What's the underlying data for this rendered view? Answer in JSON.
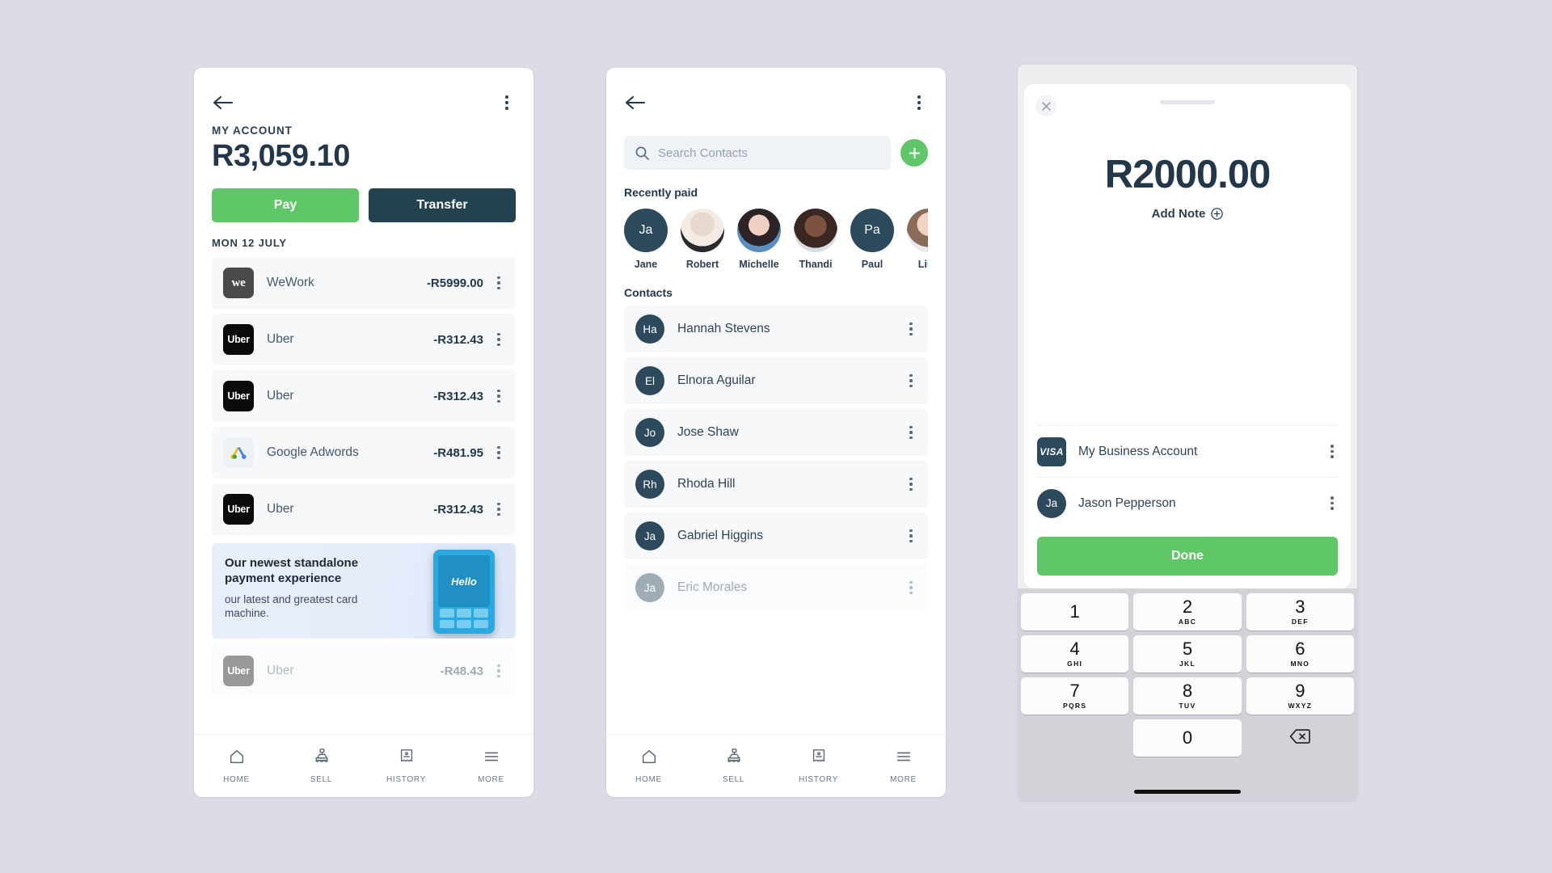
{
  "colors": {
    "green": "#5fc767",
    "dark_navy": "#23424f",
    "page_bg": "#dcdce6",
    "text_dark": "#22384a"
  },
  "phone1": {
    "back_icon": "arrow-left-icon",
    "menu_icon": "kebab-menu-icon",
    "account_label": "MY ACCOUNT",
    "balance": "R3,059.10",
    "pay_label": "Pay",
    "transfer_label": "Transfer",
    "date_label": "MON 12 JULY",
    "transactions": [
      {
        "logo": "wework-logo",
        "logo_text": "we",
        "name": "WeWork",
        "amount": "-R5999.00"
      },
      {
        "logo": "uber-logo",
        "logo_text": "Uber",
        "name": "Uber",
        "amount": "-R312.43"
      },
      {
        "logo": "uber-logo",
        "logo_text": "Uber",
        "name": "Uber",
        "amount": "-R312.43"
      },
      {
        "logo": "adwords-logo",
        "logo_text": "",
        "name": "Google Adwords",
        "amount": "-R481.95"
      },
      {
        "logo": "uber-logo",
        "logo_text": "Uber",
        "name": "Uber",
        "amount": "-R312.43"
      }
    ],
    "promo": {
      "headline": "Our newest standalone payment experience",
      "subtext": "our latest and greatest card machine.",
      "device_screen_text": "Hello"
    },
    "transaction_after_promo": {
      "logo_text": "Uber",
      "name": "Uber",
      "amount": "-R48.43"
    },
    "nav": [
      {
        "icon": "home-icon",
        "label": "HOME"
      },
      {
        "icon": "sell-icon",
        "label": "SELL"
      },
      {
        "icon": "history-icon",
        "label": "HISTORY"
      },
      {
        "icon": "more-icon",
        "label": "MORE"
      }
    ]
  },
  "phone2": {
    "back_icon": "arrow-left-icon",
    "menu_icon": "kebab-menu-icon",
    "search": {
      "icon": "search-icon",
      "placeholder": "Search Contacts",
      "value": ""
    },
    "add_button_icon": "plus-icon",
    "recently_paid_title": "Recently paid",
    "recently_paid": [
      {
        "name": "Jane",
        "initials": "Ja",
        "avatar": "initials"
      },
      {
        "name": "Robert",
        "initials": "",
        "avatar": "photo-man-beard"
      },
      {
        "name": "Michelle",
        "initials": "",
        "avatar": "photo-woman-dark-hair"
      },
      {
        "name": "Thandi",
        "initials": "",
        "avatar": "photo-woman-curly"
      },
      {
        "name": "Paul",
        "initials": "Pa",
        "avatar": "initials"
      },
      {
        "name": "Lind",
        "initials": "",
        "avatar": "photo-woman-long-hair"
      }
    ],
    "contacts_title": "Contacts",
    "contacts": [
      {
        "initials": "Ha",
        "name": "Hannah Stevens",
        "faded": false
      },
      {
        "initials": "El",
        "name": "Elnora Aguilar",
        "faded": false
      },
      {
        "initials": "Jo",
        "name": "Jose Shaw",
        "faded": false
      },
      {
        "initials": "Rh",
        "name": "Rhoda Hill",
        "faded": false
      },
      {
        "initials": "Ja",
        "name": "Gabriel Higgins",
        "faded": false
      },
      {
        "initials": "Ja",
        "name": "Eric Morales",
        "faded": true
      }
    ],
    "nav": [
      {
        "icon": "home-icon",
        "label": "HOME"
      },
      {
        "icon": "sell-icon",
        "label": "SELL"
      },
      {
        "icon": "history-icon",
        "label": "HISTORY"
      },
      {
        "icon": "more-icon",
        "label": "MORE"
      }
    ]
  },
  "phone3": {
    "close_icon": "close-icon",
    "grabber": "sheet-drag-handle",
    "amount": "R2000.00",
    "add_note_label": "Add Note",
    "add_note_icon": "plus-circle-icon",
    "rows": [
      {
        "icon": "visa-card-icon",
        "icon_text": "VISA",
        "name": "My Business Account",
        "type": "card"
      },
      {
        "icon": "avatar-icon",
        "icon_text": "Ja",
        "name": "Jason Pepperson",
        "type": "contact"
      }
    ],
    "done_label": "Done",
    "keys": [
      {
        "num": "1",
        "sub": ""
      },
      {
        "num": "2",
        "sub": "ABC"
      },
      {
        "num": "3",
        "sub": "DEF"
      },
      {
        "num": "4",
        "sub": "GHI"
      },
      {
        "num": "5",
        "sub": "JKL"
      },
      {
        "num": "6",
        "sub": "MNO"
      },
      {
        "num": "7",
        "sub": "PQRS"
      },
      {
        "num": "8",
        "sub": "TUV"
      },
      {
        "num": "9",
        "sub": "WXYZ"
      },
      {
        "num": "",
        "sub": ""
      },
      {
        "num": "0",
        "sub": ""
      },
      {
        "num": "",
        "sub": "delete-icon"
      }
    ]
  }
}
